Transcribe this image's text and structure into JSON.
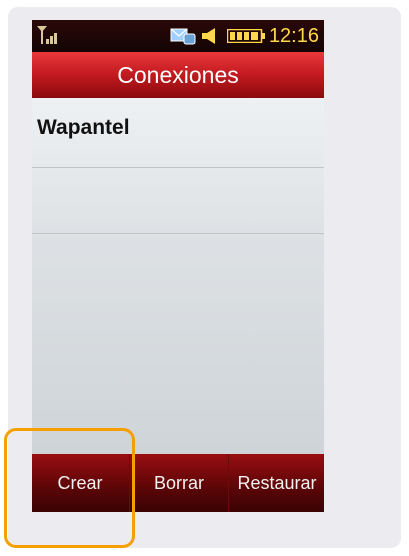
{
  "status_bar": {
    "time": "12:16",
    "icons": [
      "signal-icon",
      "message-icon",
      "speaker-icon",
      "battery-icon"
    ],
    "time_color": "#ffd84a"
  },
  "header": {
    "title": "Conexiones"
  },
  "list": {
    "items": [
      {
        "label": "Wapantel"
      },
      {
        "label": ""
      }
    ]
  },
  "softkeys": {
    "create_label": "Crear",
    "delete_label": "Borrar",
    "restore_label": "Restaurar"
  },
  "colors": {
    "title_bar": "#c11a1f",
    "softkey_bar": "#5a0507",
    "highlight": "#f5a000"
  }
}
